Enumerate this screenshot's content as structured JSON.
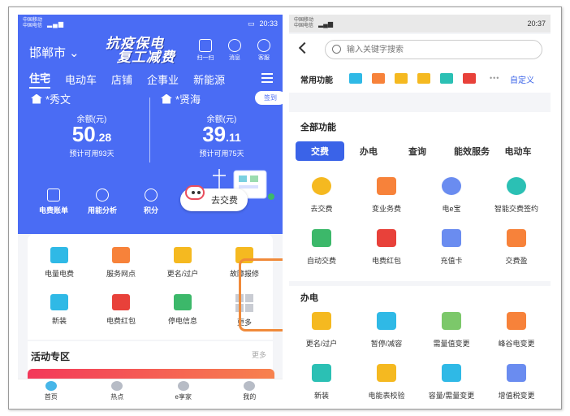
{
  "left": {
    "status": {
      "carrier1": "中国移动",
      "carrier2": "中国电信",
      "time": "20:33"
    },
    "city": "邯郸市",
    "slogan": {
      "line1": "抗疫保电",
      "line2": "复工减费"
    },
    "top_icons": [
      {
        "label": "扫一扫"
      },
      {
        "label": "消息"
      },
      {
        "label": "客服"
      }
    ],
    "tabs": [
      "住宅",
      "电动车",
      "店铺",
      "企事业",
      "新能源"
    ],
    "sign_label": "签到",
    "accounts": [
      {
        "name": "*秀文",
        "balance_label": "余额(元)",
        "amount_int": "50",
        "amount_dec": ".28",
        "days": "预计可用93天"
      },
      {
        "name": "*贤海",
        "balance_label": "余额(元)",
        "amount_int": "39",
        "amount_dec": ".11",
        "days": "预计可用75天"
      }
    ],
    "quick": [
      "电费账单",
      "用能分析",
      "积分"
    ],
    "pay_label": "去交费",
    "services": [
      {
        "label": "电量电费"
      },
      {
        "label": "服务网点"
      },
      {
        "label": "更名/过户"
      },
      {
        "label": "故障报修"
      },
      {
        "label": "新装"
      },
      {
        "label": "电费红包"
      },
      {
        "label": "停电信息"
      },
      {
        "label": "更多"
      }
    ],
    "activity": {
      "title": "活动专区",
      "more": "更多"
    },
    "bottom_nav": [
      "首页",
      "热点",
      "e享家",
      "我的"
    ]
  },
  "right": {
    "status": {
      "carrier1": "中国移动",
      "carrier2": "中国电信",
      "time": "20:37"
    },
    "search_placeholder": "输入关键字搜索",
    "common": {
      "title": "常用功能",
      "custom": "自定义"
    },
    "all": {
      "title": "全部功能",
      "tabs": [
        "交费",
        "办电",
        "查询",
        "能效服务",
        "电动车"
      ],
      "items": [
        "去交费",
        "变业务费",
        "电e宝",
        "智能交费签约",
        "自动交费",
        "电费红包",
        "充值卡",
        "交费盈"
      ]
    },
    "ban": {
      "title": "办电",
      "items": [
        "更名/过户",
        "暂停/减容",
        "需量值变更",
        "峰谷电变更",
        "新装",
        "电能表校验",
        "容量/需量变更",
        "增值税变更"
      ]
    }
  }
}
